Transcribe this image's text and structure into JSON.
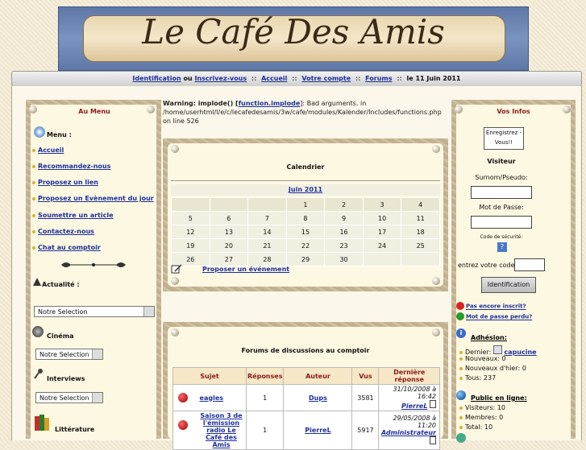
{
  "banner": {
    "title": "Le Café Des Amis"
  },
  "nav": {
    "identification": "Identification",
    "ou": "ou",
    "inscrivez": "Inscrivez-vous",
    "accueil": "Accueil",
    "compte": "Votre compte",
    "forums": "Forums",
    "date": "le 11 Juin 2011",
    "sep": "::"
  },
  "left": {
    "title": "Au Menu",
    "menu_label": "Menu :",
    "items": [
      "Accueil",
      "Recommandez-nous",
      "Proposez un lien",
      "Proposez un Evènement du jour",
      "Soumettre un article",
      "Contactez-nous",
      "Chat au comptoir"
    ],
    "actualite": "Actualité :",
    "actualite_select": "Notre Selection",
    "cinema": "Cinéma",
    "cinema_select": "Notre Selection",
    "interviews": "Interviews",
    "interviews_select": "Notre Selection",
    "litterature": "Littérature"
  },
  "warning": {
    "prefix": "Warning: implode() [",
    "func": "function.implode",
    "rest": "]: Bad arguments. in /home/userhtml/l/e/c/lecafedesamis/3w/cafe/modules/Kalender/Includes/functions.php on line 526"
  },
  "calendar": {
    "title": "Calendrier",
    "month": "Juin 2011",
    "rows": [
      [
        "",
        "",
        "1",
        "2",
        "3",
        "4"
      ],
      [
        "5",
        "6",
        "7",
        "8",
        "9",
        "10",
        "11"
      ],
      [
        "12",
        "13",
        "14",
        "15",
        "16",
        "17",
        "18"
      ],
      [
        "19",
        "20",
        "21",
        "22",
        "23",
        "24",
        "25"
      ],
      [
        "26",
        "27",
        "28",
        "29",
        "30",
        "",
        ""
      ]
    ],
    "propose": "Proposer un événement"
  },
  "forums": {
    "title": "Forums de discussions au comptoir",
    "headers": [
      "Sujet",
      "Réponses",
      "Auteur",
      "Vus",
      "Dernière réponse"
    ],
    "rows": [
      {
        "sujet": "eagles",
        "reponses": "1",
        "auteur": "Dups",
        "vus": "3581",
        "date": "31/10/2008 à 16:42",
        "last": "PierreL"
      },
      {
        "sujet": "Saison 3 de l'émission radio Le Café des Amis",
        "reponses": "1",
        "auteur": "PierreL",
        "vus": "5917",
        "date": "29/05/2008 à 11:20",
        "last": "Administrateur"
      }
    ]
  },
  "right": {
    "title": "Vos Infos",
    "enregistrez": "Enregistrez -Vous!!",
    "visiteur": "Visiteur",
    "pseudo_label": "Surnom/Pseudo:",
    "pass_label": "Mot de Passe:",
    "code_label": "Code de sécurité:",
    "code_value": "?",
    "entrez_label": "entrez votre code:",
    "login_button": "Identification",
    "not_registered": "Pas encore inscrit?",
    "lost_pass": "Mot de passe perdu?",
    "adhesion": "Adhésion:",
    "dernier_label": "Dernier:",
    "dernier_value": "capucine",
    "nouveaux": "Nouveaux: 0",
    "nouveaux_hier": "Nouveaux d'hier: 0",
    "tous": "Tous: 237",
    "public": "Public en ligne:",
    "visiteurs": "Visiteurs: 10",
    "membres": "Membres: 0",
    "total": "Total: 10"
  },
  "colors": {
    "link": "#1d2f9a",
    "title_red": "#8b1a1a",
    "banner_blue": "#6b84b4"
  }
}
